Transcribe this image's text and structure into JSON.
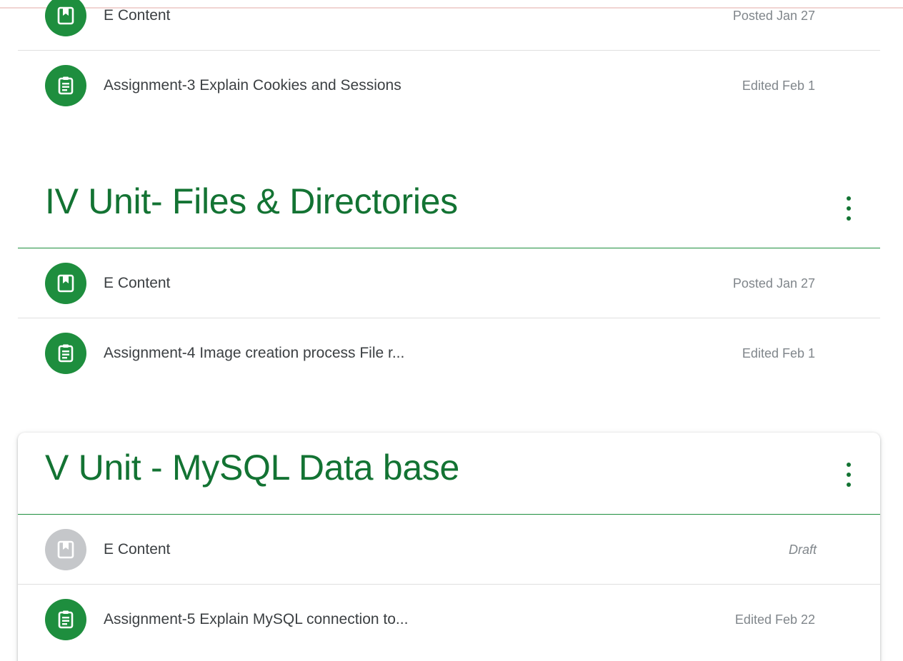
{
  "section3": {
    "items": [
      {
        "title": "E Content",
        "meta": "Posted Jan 27",
        "icon": "material-bookmark-icon",
        "status": "posted"
      },
      {
        "title": "Assignment-3 Explain Cookies and Sessions",
        "meta": "Edited Feb 1",
        "icon": "assignment-clipboard-icon",
        "status": "edited"
      }
    ]
  },
  "section4": {
    "heading": "IV Unit- Files & Directories",
    "items": [
      {
        "title": "E Content",
        "meta": "Posted Jan 27",
        "icon": "material-bookmark-icon",
        "status": "posted"
      },
      {
        "title": "Assignment-4 Image creation process File r...",
        "meta": "Edited Feb 1",
        "icon": "assignment-clipboard-icon",
        "status": "edited"
      }
    ]
  },
  "section5": {
    "heading": "V Unit - MySQL Data base",
    "items": [
      {
        "title": "E Content",
        "meta": "Draft",
        "icon": "material-bookmark-icon",
        "status": "draft"
      },
      {
        "title": "Assignment-5 Explain MySQL connection to...",
        "meta": "Edited Feb 22",
        "icon": "assignment-clipboard-icon",
        "status": "edited"
      }
    ]
  },
  "colors": {
    "accent_green": "#1e8e3e",
    "heading_green": "#137333",
    "draft_gray": "#c5c7ca",
    "text": "#3c4043",
    "meta_text": "#80868b"
  }
}
